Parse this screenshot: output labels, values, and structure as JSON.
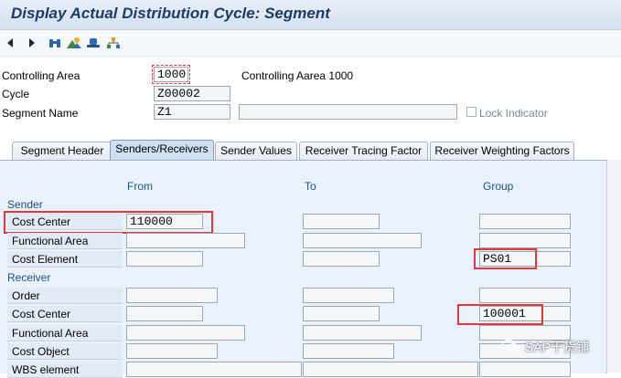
{
  "window": {
    "title": "Display Actual Distribution Cycle: Segment"
  },
  "toolbar": {
    "icons": [
      "arrow-left-icon",
      "arrow-right-icon",
      "binoculars-icon",
      "mountain-icon",
      "hat-icon",
      "tree-icon"
    ]
  },
  "header": {
    "controlling_area": {
      "label": "Controlling Area",
      "value": "1000",
      "description": "Controlling Aarea 1000"
    },
    "cycle": {
      "label": "Cycle",
      "value": "Z00002"
    },
    "segment_name": {
      "label": "Segment Name",
      "value": "Z1",
      "text_value": ""
    },
    "lock_indicator": {
      "label": "Lock Indicator",
      "checked": false
    }
  },
  "tabs": [
    {
      "label": "Segment Header",
      "active": false
    },
    {
      "label": "Senders/Receivers",
      "active": true
    },
    {
      "label": "Sender Values",
      "active": false
    },
    {
      "label": "Receiver Tracing Factor",
      "active": false
    },
    {
      "label": "Receiver Weighting Factors",
      "active": false
    }
  ],
  "columns": {
    "from": "From",
    "to": "To",
    "group": "Group"
  },
  "sender": {
    "title": "Sender",
    "rows": [
      {
        "label": "Cost Center",
        "from": "110000",
        "to": "",
        "group": ""
      },
      {
        "label": "Functional Area",
        "from": "",
        "to": "",
        "group": ""
      },
      {
        "label": "Cost Element",
        "from": "",
        "to": "",
        "group": "PS01"
      }
    ]
  },
  "receiver": {
    "title": "Receiver",
    "rows": [
      {
        "label": "Order",
        "from": "",
        "to": "",
        "group": ""
      },
      {
        "label": "Cost Center",
        "from": "",
        "to": "",
        "group": "100001"
      },
      {
        "label": "Functional Area",
        "from": "",
        "to": "",
        "group": ""
      },
      {
        "label": "Cost Object",
        "from": "",
        "to": "",
        "group": ""
      },
      {
        "label": "WBS element",
        "from": "",
        "to": "",
        "group": ""
      }
    ]
  },
  "watermark": {
    "text": "SAP干货铺"
  },
  "colors": {
    "title": "#1d3b66",
    "section": "#1d4f8c",
    "highlight": "#e0383c",
    "panel": "#e9f1fa"
  }
}
